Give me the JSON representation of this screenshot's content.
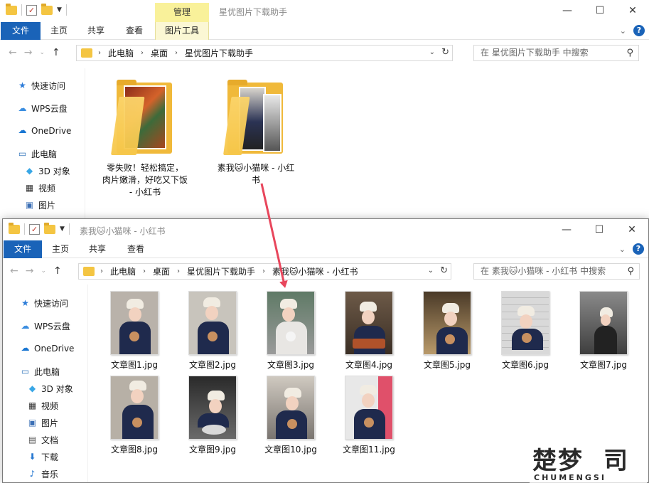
{
  "window1": {
    "title": "星优图片下载助手",
    "manage_tab": "管理",
    "tabs": [
      "文件",
      "主页",
      "共享",
      "查看",
      "图片工具"
    ],
    "breadcrumb": [
      "此电脑",
      "桌面",
      "星优图片下载助手"
    ],
    "search_placeholder": "在 星优图片下载助手 中搜索",
    "sidebar": [
      "快速访问",
      "WPS云盘",
      "OneDrive",
      "此电脑",
      "3D 对象",
      "视频",
      "图片"
    ],
    "folders": [
      {
        "name": "零失败！轻松搞定，肉片嫩滑，好吃又下饭 - 小红书",
        "lines": [
          "零失败！轻松搞定，",
          "肉片嫩滑，好吃又下饭",
          "- 小红书"
        ]
      },
      {
        "name": "素我🐱小猫咪 - 小红书",
        "lines": [
          "素我🐱小猫咪 - 小红",
          "书"
        ]
      }
    ]
  },
  "window2": {
    "title": "素我🐱小猫咪 - 小红书",
    "tabs": [
      "文件",
      "主页",
      "共享",
      "查看"
    ],
    "breadcrumb": [
      "此电脑",
      "桌面",
      "星优图片下载助手",
      "素我🐱小猫咪 - 小红书"
    ],
    "search_placeholder": "在 素我🐱小猫咪 - 小红书 中搜索",
    "sidebar": [
      "快速访问",
      "WPS云盘",
      "OneDrive",
      "此电脑",
      "3D 对象",
      "视频",
      "图片",
      "文档",
      "下载",
      "音乐"
    ],
    "files": [
      "文章图1.jpg",
      "文章图2.jpg",
      "文章图3.jpg",
      "文章图4.jpg",
      "文章图5.jpg",
      "文章图6.jpg",
      "文章图7.jpg",
      "文章图8.jpg",
      "文章图9.jpg",
      "文章图10.jpg",
      "文章图11.jpg"
    ]
  },
  "watermark": {
    "main": "楚梦",
    "sub": "CHUMENGSI"
  },
  "colors": {
    "accent": "#1a63b8",
    "arrow": "#e8465c",
    "manage_tab": "#f9f19a"
  }
}
